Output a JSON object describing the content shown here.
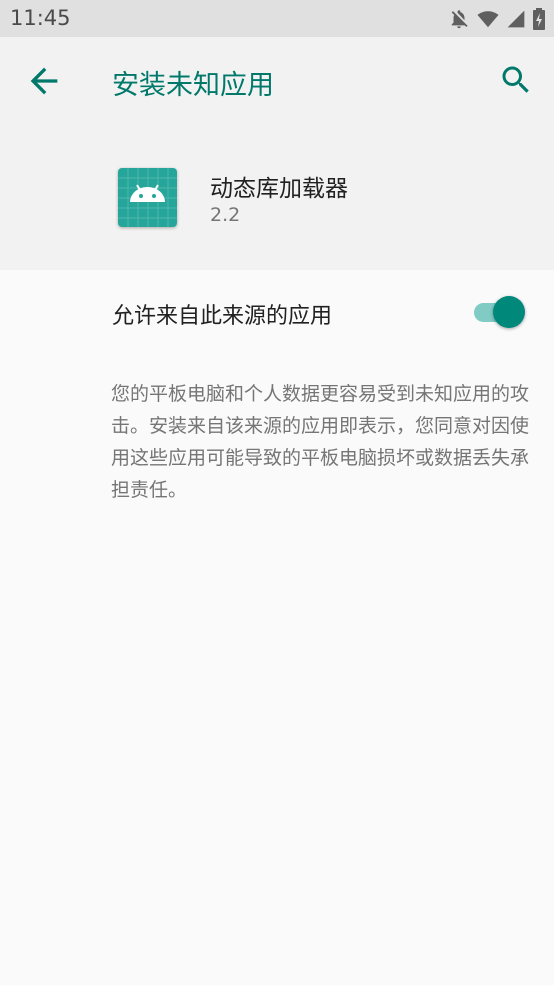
{
  "status_bar": {
    "time": "11:45",
    "icons": [
      "notifications-off-icon",
      "wifi-icon",
      "signal-icon",
      "battery-charging-icon"
    ]
  },
  "app_bar": {
    "title": "安装未知应用",
    "back_icon": "arrow-back-icon",
    "search_icon": "search-icon",
    "accent_color": "#00796b"
  },
  "app_info": {
    "name": "动态库加载器",
    "version": "2.2",
    "icon": "android-icon",
    "icon_color": "#26a69a"
  },
  "setting": {
    "label": "允许来自此来源的应用",
    "enabled": true,
    "toggle_color": "#00897b"
  },
  "description": "您的平板电脑和个人数据更容易受到未知应用的攻击。安装来自该来源的应用即表示，您同意对因使用这些应用可能导致的平板电脑损坏或数据丢失承担责任。"
}
